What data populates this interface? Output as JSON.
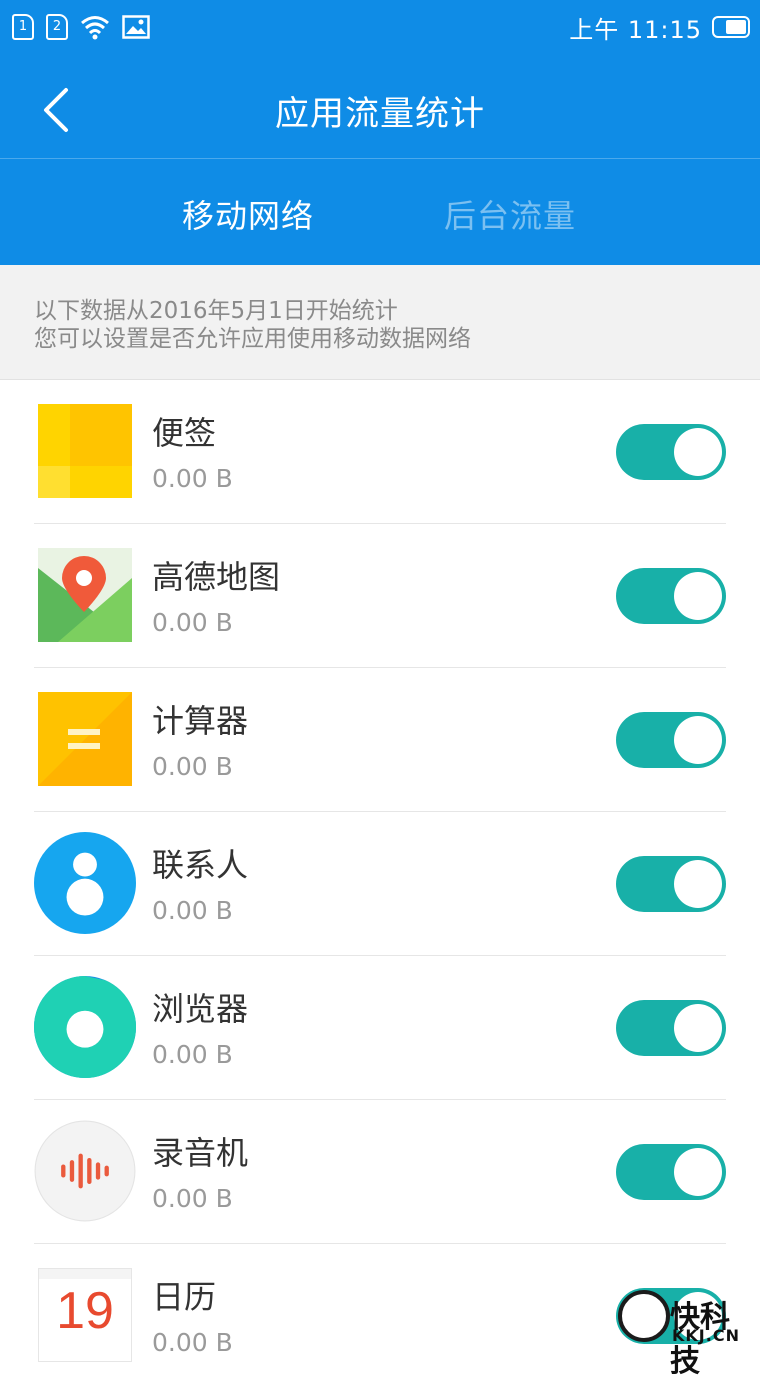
{
  "status_bar": {
    "sim1": "1",
    "sim2": "2",
    "time": "上午 11:15"
  },
  "header": {
    "title": "应用流量统计",
    "tabs": [
      {
        "label": "移动网络",
        "active": true
      },
      {
        "label": "后台流量",
        "active": false
      }
    ]
  },
  "notice": {
    "line1": "以下数据从2016年5月1日开始统计",
    "line2": "您可以设置是否允许应用使用移动数据网络"
  },
  "apps": [
    {
      "name": "便签",
      "usage": "0.00 B",
      "enabled": true,
      "icon": "notes-icon"
    },
    {
      "name": " 高德地图",
      "usage": "0.00 B",
      "enabled": true,
      "icon": "map-icon"
    },
    {
      "name": "计算器",
      "usage": "0.00 B",
      "enabled": true,
      "icon": "calculator-icon"
    },
    {
      "name": "联系人",
      "usage": "0.00 B",
      "enabled": true,
      "icon": "contacts-icon"
    },
    {
      "name": "浏览器",
      "usage": "0.00 B",
      "enabled": true,
      "icon": "browser-icon"
    },
    {
      "name": "录音机",
      "usage": "0.00 B",
      "enabled": true,
      "icon": "recorder-icon"
    },
    {
      "name": "日历",
      "usage": "0.00 B",
      "enabled": true,
      "icon": "calendar-icon",
      "icon_text": "19"
    }
  ],
  "watermark": {
    "text": "快科技",
    "sub": "KKJ.CN"
  },
  "colors": {
    "header": "#0f8ce6",
    "toggle_on": "#18b0a8"
  }
}
